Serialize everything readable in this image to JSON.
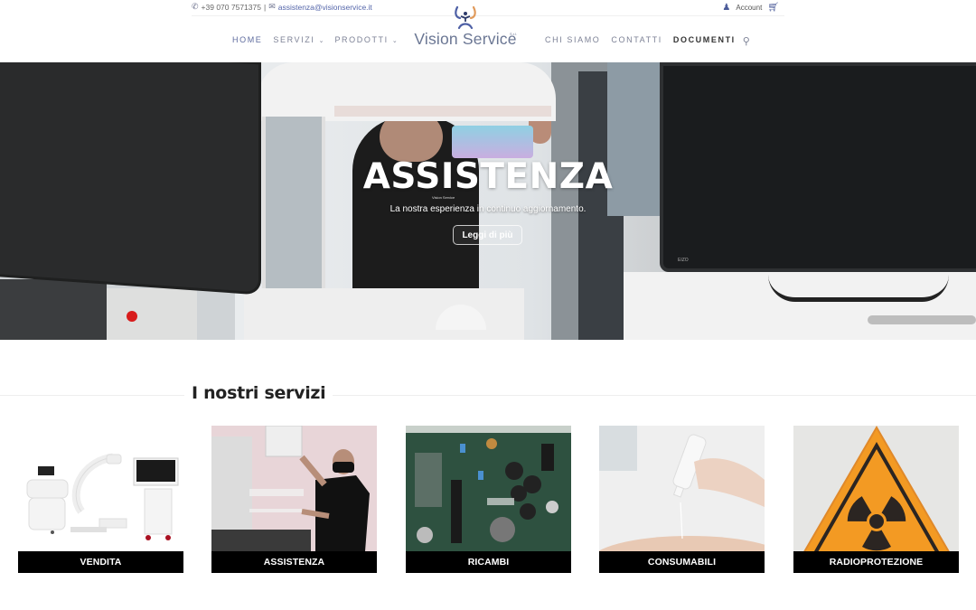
{
  "topbar": {
    "phone_icon": "phone-icon",
    "phone": "+39 070 7571375",
    "separator": "|",
    "email_icon": "envelope-icon",
    "email": "assistenza@visionservice.it",
    "account_icon": "user-icon",
    "account_label": "Account",
    "cart_icon": "cart-icon"
  },
  "logo": {
    "brand": "Vision Service",
    "suffix": "S.r.l."
  },
  "nav": {
    "left": [
      {
        "label": "HOME",
        "active": true
      },
      {
        "label": "SERVIZI",
        "dropdown": true
      },
      {
        "label": "PRODOTTI",
        "dropdown": true
      }
    ],
    "right": [
      {
        "label": "CHI SIAMO"
      },
      {
        "label": "CONTATTI"
      },
      {
        "label": "DOCUMENTI",
        "bold": true
      }
    ],
    "chevron": "⌄",
    "search_icon": "search-icon"
  },
  "hero": {
    "title": "ASSISTENZA",
    "mini_logo": "Vision Service",
    "subtitle": "La nostra  esperienza in continuo aggiornamento.",
    "button": "Leggi di più",
    "monitor_brand": "EIZO"
  },
  "services": {
    "title": "I nostri servizi",
    "items": [
      {
        "label": "VENDITA"
      },
      {
        "label": "ASSISTENZA"
      },
      {
        "label": "RICAMBI"
      },
      {
        "label": "CONSUMABILI"
      },
      {
        "label": "RADIOPROTEZIONE"
      }
    ]
  },
  "colors": {
    "brand_blue": "#6a7693",
    "nav_text": "#7d8296",
    "accent_icon": "#4b5b99",
    "warning_orange": "#f39a23"
  }
}
